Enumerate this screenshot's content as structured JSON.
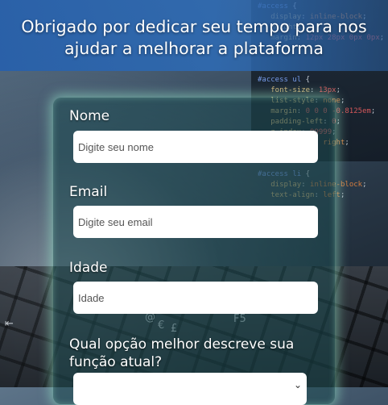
{
  "page": {
    "title": "Obrigado por dedicar seu tempo para nos ajudar a melhorar a plataforma"
  },
  "form": {
    "name_label": "Nome",
    "name_placeholder": "Digite seu nome",
    "email_label": "Email",
    "email_placeholder": "Digite seu email",
    "age_label": "Idade",
    "age_placeholder": "Idade",
    "role_question": "Qual opção melhor descreve sua função atual?",
    "role_selected": ""
  },
  "colors": {
    "title_band": "#2e6ab2",
    "card_glow": "#96e6c8",
    "input_bg": "#ffffff"
  }
}
